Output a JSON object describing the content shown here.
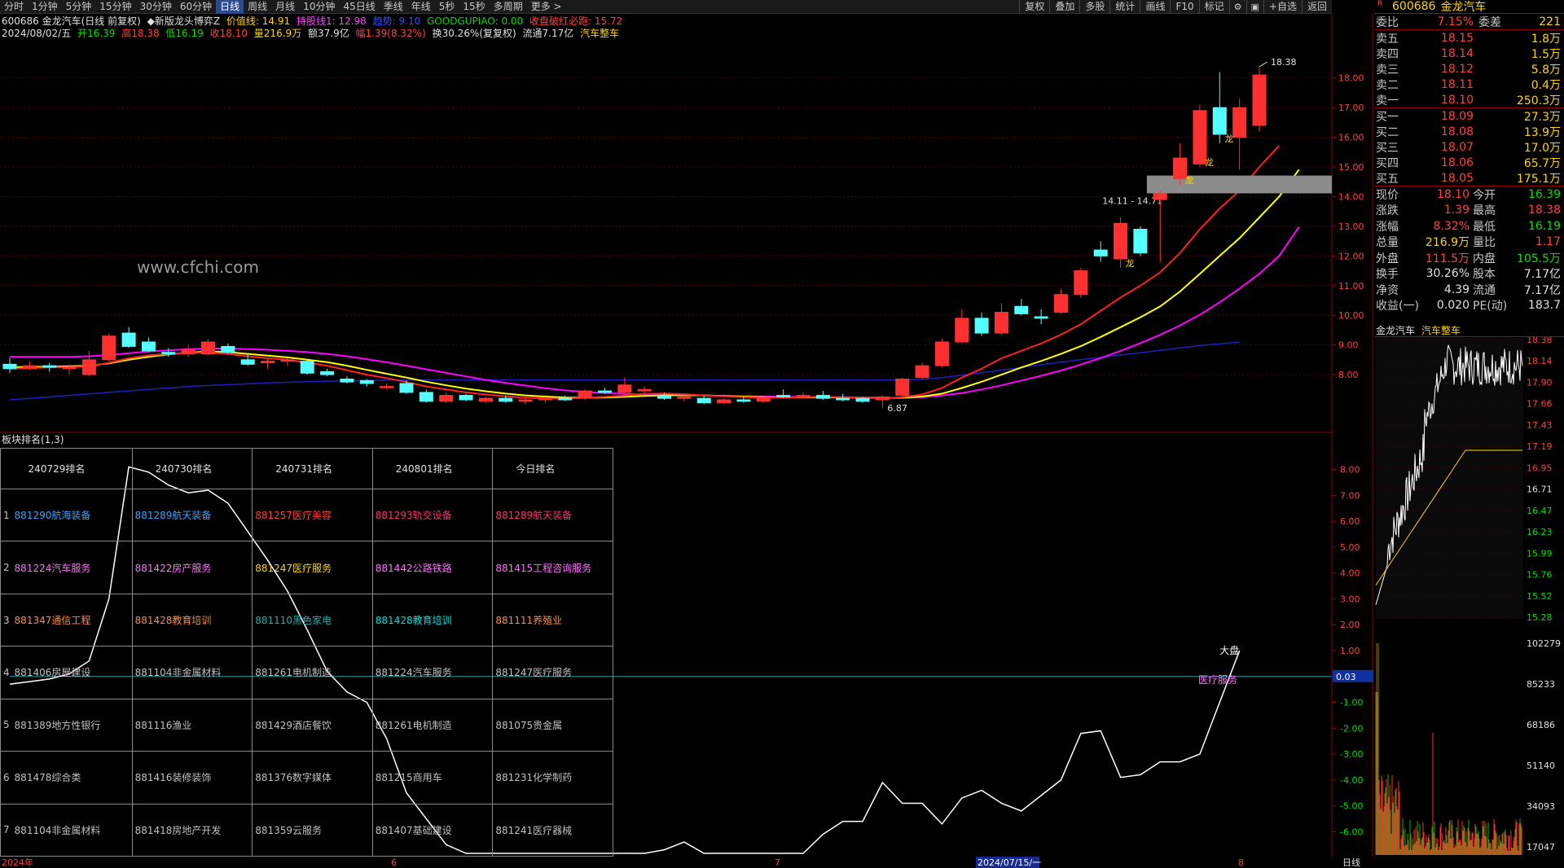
{
  "toolbar": {
    "periods": [
      "分时",
      "1分钟",
      "5分钟",
      "15分钟",
      "30分钟",
      "60分钟",
      "日线",
      "周线",
      "月线",
      "10分钟",
      "45日线",
      "季线",
      "年线",
      "5秒",
      "15秒",
      "多周期",
      "更多 >"
    ],
    "active_period": "日线",
    "tools": [
      "复权",
      "叠加",
      "多股",
      "统计",
      "画线",
      "F10",
      "标记"
    ],
    "icon_settings": "gear-icon",
    "icon_window": "window-icon",
    "add_label": "+自选",
    "back_label": "返回"
  },
  "header": {
    "code_name": "600686 金龙汽车(日线 前复权)",
    "formula": "◆新版龙头博弈Z",
    "val_line_label": "价值线: 14.91",
    "hold_line_label": "持股线1: 12.98",
    "trend_label": "趋势: 9.10",
    "goodgupiao_label": "GOODGUPIAO: 0.00",
    "close_red_label": "收盘破红必跑: 15.72",
    "date": "2024/08/02/五",
    "open": "开16.39",
    "high": "高18.38",
    "low": "低16.19",
    "close": "收18.10",
    "volume": "量216.9万",
    "amount": "额37.9亿",
    "range": "幅1.39(8.32%)",
    "turnover": "换30.26%(复复权)",
    "float": "流通7.17亿",
    "sector": "汽车整车"
  },
  "chart_data": {
    "type": "candlestick",
    "price_axis": {
      "ticks": [
        18.0,
        17.0,
        16.0,
        15.0,
        14.0,
        13.0,
        12.0,
        11.0,
        10.0,
        9.0,
        8.0
      ],
      "range": [
        6.3,
        19.2
      ]
    },
    "candles": [
      {
        "o": 8.35,
        "h": 8.55,
        "l": 8.05,
        "c": 8.2
      },
      {
        "o": 8.2,
        "h": 8.45,
        "l": 8.15,
        "c": 8.3
      },
      {
        "o": 8.3,
        "h": 8.4,
        "l": 8.1,
        "c": 8.25
      },
      {
        "o": 8.2,
        "h": 8.35,
        "l": 8.0,
        "c": 8.25
      },
      {
        "o": 8.0,
        "h": 8.8,
        "l": 7.95,
        "c": 8.5
      },
      {
        "o": 8.5,
        "h": 9.4,
        "l": 8.45,
        "c": 9.3
      },
      {
        "o": 9.4,
        "h": 9.6,
        "l": 8.9,
        "c": 8.95
      },
      {
        "o": 9.1,
        "h": 9.25,
        "l": 8.75,
        "c": 8.8
      },
      {
        "o": 8.75,
        "h": 8.9,
        "l": 8.6,
        "c": 8.7
      },
      {
        "o": 8.7,
        "h": 9.0,
        "l": 8.6,
        "c": 8.85
      },
      {
        "o": 8.7,
        "h": 9.2,
        "l": 8.65,
        "c": 9.1
      },
      {
        "o": 8.95,
        "h": 9.05,
        "l": 8.7,
        "c": 8.75
      },
      {
        "o": 8.5,
        "h": 8.7,
        "l": 8.3,
        "c": 8.35
      },
      {
        "o": 8.4,
        "h": 8.55,
        "l": 8.2,
        "c": 8.45
      },
      {
        "o": 8.45,
        "h": 8.55,
        "l": 8.3,
        "c": 8.5
      },
      {
        "o": 8.45,
        "h": 8.5,
        "l": 8.0,
        "c": 8.05
      },
      {
        "o": 8.1,
        "h": 8.2,
        "l": 7.95,
        "c": 8.0
      },
      {
        "o": 7.85,
        "h": 7.95,
        "l": 7.7,
        "c": 7.75
      },
      {
        "o": 7.8,
        "h": 7.85,
        "l": 7.6,
        "c": 7.7
      },
      {
        "o": 7.6,
        "h": 7.7,
        "l": 7.5,
        "c": 7.6
      },
      {
        "o": 7.7,
        "h": 7.8,
        "l": 7.35,
        "c": 7.4
      },
      {
        "o": 7.4,
        "h": 7.5,
        "l": 7.05,
        "c": 7.1
      },
      {
        "o": 7.1,
        "h": 7.4,
        "l": 7.05,
        "c": 7.3
      },
      {
        "o": 7.3,
        "h": 7.35,
        "l": 7.1,
        "c": 7.15
      },
      {
        "o": 7.1,
        "h": 7.25,
        "l": 7.05,
        "c": 7.2
      },
      {
        "o": 7.2,
        "h": 7.3,
        "l": 7.05,
        "c": 7.1
      },
      {
        "o": 7.1,
        "h": 7.2,
        "l": 7.0,
        "c": 7.15
      },
      {
        "o": 7.15,
        "h": 7.25,
        "l": 7.05,
        "c": 7.2
      },
      {
        "o": 7.2,
        "h": 7.3,
        "l": 7.1,
        "c": 7.15
      },
      {
        "o": 7.2,
        "h": 7.5,
        "l": 7.15,
        "c": 7.45
      },
      {
        "o": 7.45,
        "h": 7.55,
        "l": 7.35,
        "c": 7.4
      },
      {
        "o": 7.4,
        "h": 7.9,
        "l": 7.35,
        "c": 7.65
      },
      {
        "o": 7.45,
        "h": 7.6,
        "l": 7.35,
        "c": 7.5
      },
      {
        "o": 7.3,
        "h": 7.4,
        "l": 7.15,
        "c": 7.2
      },
      {
        "o": 7.2,
        "h": 7.3,
        "l": 7.1,
        "c": 7.25
      },
      {
        "o": 7.2,
        "h": 7.3,
        "l": 7.0,
        "c": 7.05
      },
      {
        "o": 7.05,
        "h": 7.2,
        "l": 7.0,
        "c": 7.15
      },
      {
        "o": 7.15,
        "h": 7.25,
        "l": 7.05,
        "c": 7.1
      },
      {
        "o": 7.1,
        "h": 7.25,
        "l": 7.05,
        "c": 7.2
      },
      {
        "o": 7.3,
        "h": 7.5,
        "l": 7.2,
        "c": 7.25
      },
      {
        "o": 7.25,
        "h": 7.4,
        "l": 7.2,
        "c": 7.3
      },
      {
        "o": 7.3,
        "h": 7.45,
        "l": 7.15,
        "c": 7.2
      },
      {
        "o": 7.2,
        "h": 7.35,
        "l": 7.1,
        "c": 7.15
      },
      {
        "o": 7.2,
        "h": 7.25,
        "l": 7.05,
        "c": 7.1
      },
      {
        "o": 7.15,
        "h": 7.3,
        "l": 6.87,
        "c": 7.25
      },
      {
        "o": 7.3,
        "h": 7.9,
        "l": 7.25,
        "c": 7.85
      },
      {
        "o": 7.9,
        "h": 8.4,
        "l": 7.85,
        "c": 8.3
      },
      {
        "o": 8.3,
        "h": 9.2,
        "l": 8.25,
        "c": 9.1
      },
      {
        "o": 9.1,
        "h": 10.2,
        "l": 9.05,
        "c": 9.9
      },
      {
        "o": 9.9,
        "h": 10.1,
        "l": 9.3,
        "c": 9.4
      },
      {
        "o": 9.4,
        "h": 10.4,
        "l": 9.35,
        "c": 10.1
      },
      {
        "o": 10.3,
        "h": 10.55,
        "l": 10.0,
        "c": 10.05
      },
      {
        "o": 9.95,
        "h": 10.2,
        "l": 9.7,
        "c": 9.9
      },
      {
        "o": 10.1,
        "h": 10.9,
        "l": 10.05,
        "c": 10.7
      },
      {
        "o": 10.7,
        "h": 11.6,
        "l": 10.6,
        "c": 11.5
      },
      {
        "o": 12.2,
        "h": 12.5,
        "l": 11.8,
        "c": 12.0
      },
      {
        "o": 11.9,
        "h": 13.3,
        "l": 11.6,
        "c": 13.1
      },
      {
        "o": 12.9,
        "h": 13.0,
        "l": 12.0,
        "c": 12.1
      },
      {
        "o": 13.9,
        "h": 14.2,
        "l": 11.8,
        "c": 14.1
      },
      {
        "o": 14.6,
        "h": 15.8,
        "l": 14.4,
        "c": 15.3
      },
      {
        "o": 15.1,
        "h": 17.1,
        "l": 15.0,
        "c": 16.9
      },
      {
        "o": 17.0,
        "h": 18.2,
        "l": 15.8,
        "c": 16.1
      },
      {
        "o": 16.0,
        "h": 17.3,
        "l": 14.9,
        "c": 17.0
      },
      {
        "o": 16.4,
        "h": 18.38,
        "l": 16.19,
        "c": 18.1
      }
    ],
    "ma_red": [
      8.2,
      8.22,
      8.24,
      8.25,
      8.28,
      8.4,
      8.55,
      8.65,
      8.7,
      8.72,
      8.75,
      8.7,
      8.62,
      8.55,
      8.5,
      8.4,
      8.3,
      8.15,
      8.0,
      7.88,
      7.75,
      7.6,
      7.5,
      7.4,
      7.33,
      7.27,
      7.22,
      7.2,
      7.19,
      7.22,
      7.25,
      7.3,
      7.35,
      7.36,
      7.34,
      7.3,
      7.27,
      7.24,
      7.22,
      7.23,
      7.24,
      7.25,
      7.24,
      7.22,
      7.2,
      7.24,
      7.33,
      7.55,
      7.9,
      8.2,
      8.55,
      8.8,
      9.05,
      9.35,
      9.7,
      10.15,
      10.6,
      11.0,
      11.45,
      12.1,
      12.9,
      13.6,
      14.2,
      15.0,
      15.72
    ],
    "ma_yellow": [
      8.25,
      8.26,
      8.27,
      8.28,
      8.3,
      8.38,
      8.5,
      8.6,
      8.68,
      8.74,
      8.78,
      8.76,
      8.7,
      8.64,
      8.58,
      8.5,
      8.42,
      8.3,
      8.16,
      8.03,
      7.9,
      7.76,
      7.64,
      7.53,
      7.44,
      7.36,
      7.3,
      7.26,
      7.23,
      7.22,
      7.23,
      7.25,
      7.28,
      7.3,
      7.31,
      7.3,
      7.28,
      7.26,
      7.24,
      7.23,
      7.23,
      7.23,
      7.23,
      7.22,
      7.21,
      7.22,
      7.26,
      7.36,
      7.55,
      7.76,
      8.0,
      8.24,
      8.46,
      8.7,
      8.96,
      9.27,
      9.6,
      9.93,
      10.3,
      10.8,
      11.4,
      12.0,
      12.6,
      13.3,
      14.0,
      14.91
    ],
    "ma_magenta": [
      8.6,
      8.6,
      8.6,
      8.6,
      8.62,
      8.66,
      8.72,
      8.78,
      8.82,
      8.86,
      8.88,
      8.88,
      8.86,
      8.84,
      8.8,
      8.76,
      8.7,
      8.62,
      8.52,
      8.42,
      8.3,
      8.18,
      8.06,
      7.94,
      7.82,
      7.72,
      7.63,
      7.54,
      7.47,
      7.42,
      7.38,
      7.35,
      7.33,
      7.32,
      7.31,
      7.3,
      7.28,
      7.27,
      7.26,
      7.25,
      7.25,
      7.24,
      7.24,
      7.23,
      7.22,
      7.22,
      7.24,
      7.3,
      7.38,
      7.5,
      7.64,
      7.8,
      7.96,
      8.14,
      8.34,
      8.56,
      8.8,
      9.06,
      9.34,
      9.66,
      10.02,
      10.44,
      10.9,
      11.4,
      12.0,
      12.98
    ],
    "ma_blue": [
      7.15,
      7.2,
      7.25,
      7.3,
      7.35,
      7.4,
      7.45,
      7.5,
      7.55,
      7.6,
      7.63,
      7.66,
      7.69,
      7.72,
      7.74,
      7.76,
      7.78,
      7.79,
      7.8,
      7.81,
      7.82,
      7.82,
      7.82,
      7.82,
      7.82,
      7.82,
      7.82,
      7.82,
      7.82,
      7.82,
      7.82,
      7.82,
      7.82,
      7.82,
      7.82,
      7.82,
      7.82,
      7.82,
      7.82,
      7.82,
      7.82,
      7.82,
      7.82,
      7.82,
      7.82,
      7.82,
      7.84,
      7.9,
      7.98,
      8.06,
      8.15,
      8.24,
      8.33,
      8.42,
      8.5,
      8.58,
      8.66,
      8.74,
      8.82,
      8.9,
      8.98,
      9.04,
      9.1
    ],
    "annotations": {
      "high_label": "18.38",
      "low_label": "6.87",
      "zone_label": "14.11 - 14.71",
      "dragon": "龙",
      "x_months": [
        "2024年",
        "6",
        "7",
        "2024/07/15/一",
        "8",
        "日线"
      ]
    },
    "lower_axis": {
      "ticks": [
        8.0,
        7.0,
        6.0,
        5.0,
        4.0,
        3.0,
        2.0,
        1.0,
        0.0,
        -1.0,
        -2.0,
        -3.0,
        -4.0,
        -5.0,
        -6.0
      ],
      "current": "0.03"
    },
    "lower_line": [
      -0.3,
      -0.2,
      -0.1,
      0.1,
      0.6,
      3.0,
      8.1,
      7.9,
      7.4,
      7.1,
      7.2,
      6.7,
      5.6,
      4.5,
      3.3,
      1.8,
      0.2,
      -0.6,
      -1.0,
      -2.4,
      -4.5,
      -5.5,
      -6.5,
      -7.0,
      -9.2,
      -9.2,
      -9.0,
      -8.2,
      -7.8,
      -7.1,
      -7.0,
      -7.6,
      -7.3,
      -6.7,
      -6.4,
      -7.1,
      -8.4,
      -7.7,
      -7.9,
      -7.3,
      -6.9,
      -6.1,
      -5.6,
      -5.6,
      -4.1,
      -4.9,
      -4.9,
      -5.7,
      -4.7,
      -4.4,
      -4.9,
      -5.2,
      -4.6,
      -4.0,
      -2.2,
      -2.1,
      -3.9,
      -3.8,
      -3.3,
      -3.3,
      -3.0,
      -1.0,
      1.0
    ],
    "lower_label_big": "大盘",
    "lower_label_side": "医疗服务",
    "mini": {
      "ticks": [
        "18.38",
        "18.14",
        "17.90",
        "17.66",
        "17.43",
        "17.19",
        "16.95",
        "16.71",
        "16.47",
        "16.23",
        "15.99",
        "15.76",
        "15.52",
        "15.28",
        "102279",
        "85233",
        "68186",
        "51140",
        "34093",
        "17047"
      ]
    }
  },
  "sub_panel": {
    "title": "板块排名(1,3)"
  },
  "ranking_table": {
    "headers": [
      "240729排名",
      "240730排名",
      "240731排名",
      "240801排名",
      "今日排名"
    ],
    "rows": [
      {
        "n": "1",
        "cells": [
          "881290航海装备",
          "881289航天装备",
          "881257医疗美容",
          "881293轨交设备",
          "881289航天装备"
        ]
      },
      {
        "n": "2",
        "cells": [
          "881224汽车服务",
          "881422房产服务",
          "881247医疗服务",
          "881442公路铁路",
          "881415工程咨询服务"
        ]
      },
      {
        "n": "3",
        "cells": [
          "881347通信工程",
          "881428教育培训",
          "881110黑色家电",
          "881428教育培训",
          "881111养殖业"
        ]
      },
      {
        "n": "4",
        "cells": [
          "881406房屋建设",
          "881104非金属材料",
          "881261电机制造",
          "881224汽车服务",
          "881247医疗服务"
        ]
      },
      {
        "n": "5",
        "cells": [
          "881389地方性银行",
          "881116渔业",
          "881429酒店餐饮",
          "881261电机制造",
          "881075贵金属"
        ]
      },
      {
        "n": "6",
        "cells": [
          "881478综合类",
          "881416装修装饰",
          "881376数字媒体",
          "881215商用车",
          "881231化学制药"
        ]
      },
      {
        "n": "7",
        "cells": [
          "881104非金属材料",
          "881418房地产开发",
          "881359云服务",
          "881407基础建设",
          "881241医疗器械"
        ]
      }
    ],
    "colors": [
      [
        "#3fa0ff",
        "#3fa0ff",
        "#ff4040",
        "#ff3070",
        "#ff3070"
      ],
      [
        "#ff70ff",
        "#ff70ff",
        "#ffd600",
        "#ff70ff",
        "#ff70ff"
      ],
      [
        "#ff8c3c",
        "#ff8c3c",
        "#20b0b0",
        "#00e0e0",
        "#ff8c3c"
      ],
      [
        "#c0c0c0",
        "#c0c0c0",
        "#c0c0c0",
        "#c0c0c0",
        "#c0c0c0"
      ],
      [
        "#c0c0c0",
        "#c0c0c0",
        "#c0c0c0",
        "#c0c0c0",
        "#c0c0c0"
      ],
      [
        "#c0c0c0",
        "#c0c0c0",
        "#c0c0c0",
        "#c0c0c0",
        "#c0c0c0"
      ],
      [
        "#c0c0c0",
        "#c0c0c0",
        "#c0c0c0",
        "#c0c0c0",
        "#c0c0c0"
      ]
    ]
  },
  "watermark": "www.cfchi.com",
  "quote": {
    "code": "600686",
    "name": "金龙汽车",
    "ratio_label": "委比",
    "ratio": "7.15%",
    "diff_label": "委差",
    "diff": "221",
    "asks": [
      {
        "l": "卖五",
        "p": "18.15",
        "v": "1.8万"
      },
      {
        "l": "卖四",
        "p": "18.14",
        "v": "1.5万"
      },
      {
        "l": "卖三",
        "p": "18.12",
        "v": "5.8万"
      },
      {
        "l": "卖二",
        "p": "18.11",
        "v": "0.4万"
      },
      {
        "l": "卖一",
        "p": "18.10",
        "v": "250.3万"
      }
    ],
    "bids": [
      {
        "l": "买一",
        "p": "18.09",
        "v": "27.3万"
      },
      {
        "l": "买二",
        "p": "18.08",
        "v": "13.9万"
      },
      {
        "l": "买三",
        "p": "18.07",
        "v": "17.0万"
      },
      {
        "l": "买四",
        "p": "18.06",
        "v": "65.7万"
      },
      {
        "l": "买五",
        "p": "18.05",
        "v": "175.1万"
      }
    ],
    "stats": [
      {
        "l1": "现价",
        "v1": "18.10",
        "c1": "red",
        "l2": "今开",
        "v2": "16.39",
        "c2": "grn"
      },
      {
        "l1": "涨跌",
        "v1": "1.39",
        "c1": "red",
        "l2": "最高",
        "v2": "18.38",
        "c2": "red"
      },
      {
        "l1": "涨幅",
        "v1": "8.32%",
        "c1": "red",
        "l2": "最低",
        "v2": "16.19",
        "c2": "grn"
      },
      {
        "l1": "总量",
        "v1": "216.9万",
        "c1": "yel",
        "l2": "量比",
        "v2": "1.17",
        "c2": "red"
      },
      {
        "l1": "外盘",
        "v1": "111.5万",
        "c1": "red",
        "l2": "内盘",
        "v2": "105.5万",
        "c2": "grn"
      },
      {
        "l1": "换手",
        "v1": "30.26%",
        "c1": "wht",
        "l2": "股本",
        "v2": "7.17亿",
        "c2": "wht"
      },
      {
        "l1": "净资",
        "v1": "4.39",
        "c1": "wht",
        "l2": "流通",
        "v2": "7.17亿",
        "c2": "wht"
      },
      {
        "l1": "收益(一)",
        "v1": "0.020",
        "c1": "wht",
        "l2": "PE(动)",
        "v2": "183.7",
        "c2": "wht"
      }
    ],
    "mini_title": "金龙汽车",
    "mini_sector": "汽车整车"
  },
  "colors": {
    "up": "#ff3030",
    "down": "#54ffff",
    "ma_red": "#ff2020",
    "ma_yellow": "#ffff00",
    "ma_magenta": "#ff00ff",
    "ma_blue": "#2020c0",
    "grid": "#8b0000"
  }
}
